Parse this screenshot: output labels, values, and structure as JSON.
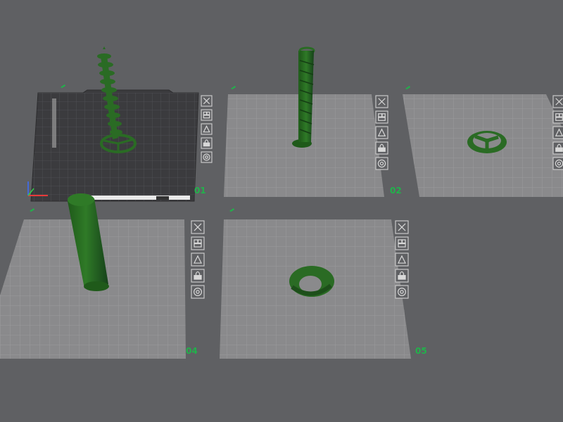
{
  "plates": [
    {
      "id": "plate-1",
      "label": "01",
      "active": true,
      "object": "spiral-tower"
    },
    {
      "id": "plate-2",
      "label": "02",
      "active": false,
      "object": "spiral-tube"
    },
    {
      "id": "plate-3",
      "label": "03",
      "active": false,
      "object": "wheel-disk"
    },
    {
      "id": "plate-4",
      "label": "04",
      "active": false,
      "object": "cylinder"
    },
    {
      "id": "plate-5",
      "label": "05",
      "active": false,
      "object": "ring-bowl"
    }
  ],
  "plate_tools": [
    "close-icon",
    "arrange-icon",
    "orient-icon",
    "lock-icon",
    "settings-icon"
  ],
  "colors": {
    "background": "#5f6063",
    "plate_active": "#3b3b3e",
    "plate_inactive": "#8a8a8c",
    "model": "#2a6b24",
    "label_green": "#21b24b"
  }
}
